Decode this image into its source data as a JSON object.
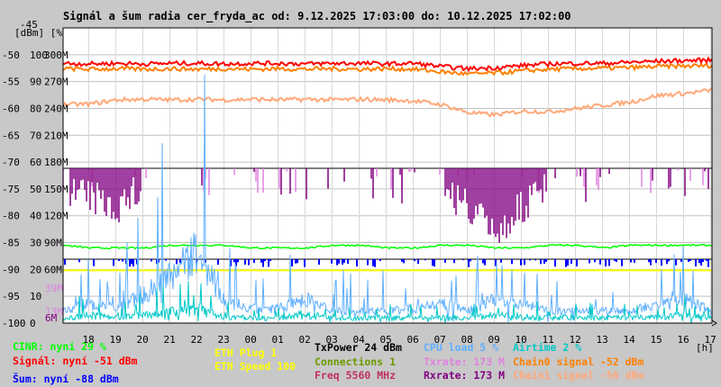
{
  "chart_data": {
    "type": "line",
    "title": "Signál a šum radia cer_fryda_ac od: 9.12.2025 17:03:00 do: 10.12.2025 17:02:00",
    "xlabel": "[h]",
    "ylabel_left": "[dBm] [%]",
    "x_ticks": [
      "18",
      "19",
      "20",
      "21",
      "22",
      "23",
      "00",
      "01",
      "02",
      "03",
      "04",
      "05",
      "06",
      "07",
      "08",
      "09",
      "10",
      "11",
      "12",
      "13",
      "14",
      "15",
      "16",
      "17"
    ],
    "y_ticks_dbm": [
      "-45",
      "-50",
      "-55",
      "-60",
      "-65",
      "-70",
      "-75",
      "-80",
      "-85",
      "-90",
      "-95",
      "-100"
    ],
    "y_ticks_pct": [
      "100",
      "90",
      "80",
      "70",
      "60",
      "50",
      "40",
      "30",
      "20",
      "10",
      "0"
    ],
    "y_ticks_rate": [
      "300M",
      "270M",
      "240M",
      "210M",
      "180M",
      "150M",
      "120M",
      "90M",
      "60M"
    ],
    "extra_rate_ticks": [
      "39M",
      "13M",
      "6M"
    ],
    "ylim_dbm": [
      -100,
      -45
    ],
    "x_hours_since_start": [
      0,
      1,
      2,
      3,
      4,
      5,
      6,
      7,
      8,
      9,
      10,
      11,
      12,
      13,
      14,
      15,
      16,
      17,
      18,
      19,
      20,
      21,
      22,
      23,
      24
    ],
    "series": [
      {
        "name": "Signal",
        "unit": "dBm",
        "color": "#ff0000",
        "values": [
          -51.6,
          -51.7,
          -51.6,
          -51.7,
          -51.6,
          -51.6,
          -51.7,
          -51.6,
          -51.6,
          -51.7,
          -51.6,
          -51.6,
          -51.7,
          -51.6,
          -52.2,
          -52.6,
          -52.4,
          -52.0,
          -51.7,
          -51.6,
          -51.6,
          -51.4,
          -51.2,
          -51.1,
          -51.0
        ]
      },
      {
        "name": "Chain0 signal",
        "unit": "dBm",
        "color": "#ff8000",
        "values": [
          -52.6,
          -52.7,
          -52.6,
          -52.7,
          -52.6,
          -52.7,
          -52.6,
          -52.7,
          -52.6,
          -52.7,
          -52.6,
          -52.7,
          -52.6,
          -52.7,
          -53.2,
          -53.6,
          -53.4,
          -53.0,
          -52.7,
          -52.6,
          -52.5,
          -52.4,
          -52.2,
          -52.1,
          -52.0
        ]
      },
      {
        "name": "Chain1 signal",
        "unit": "dBm",
        "color": "#ffa878",
        "values": [
          -59.3,
          -59.2,
          -58.4,
          -58.3,
          -58.4,
          -58.3,
          -58.4,
          -58.3,
          -58.4,
          -58.3,
          -58.4,
          -58.3,
          -58.4,
          -58.6,
          -59.3,
          -60.8,
          -61.2,
          -60.5,
          -60.6,
          -60.0,
          -59.4,
          -58.8,
          -57.6,
          -57.2,
          -56.6
        ]
      },
      {
        "name": "Noise",
        "unit": "dBm",
        "color": "#0000ff",
        "values": [
          -88.1,
          -88.1,
          -88.1,
          -88.1,
          -88.1,
          -88.1,
          -88.1,
          -88.1,
          -88.1,
          -88.1,
          -88.1,
          -88.1,
          -88.1,
          -88.1,
          -88.1,
          -88.1,
          -88.1,
          -88.1,
          -88.1,
          -88.1,
          -88.1,
          -88.1,
          -88.1,
          -88.1,
          -88.1
        ]
      },
      {
        "name": "CINR",
        "unit": "%",
        "color": "#00ff00",
        "values": [
          29,
          28,
          28,
          28,
          29,
          29,
          29,
          28,
          28,
          28,
          29,
          29,
          28,
          28,
          29,
          29,
          28,
          28,
          29,
          29,
          28,
          29,
          29,
          29,
          29
        ]
      },
      {
        "name": "Txrate",
        "unit": "M",
        "color": "#e080e0",
        "values": [
          173,
          173,
          173,
          173,
          173,
          173,
          173,
          173,
          173,
          173,
          173,
          173,
          173,
          173,
          173,
          173,
          173,
          173,
          173,
          173,
          173,
          173,
          173,
          173,
          173
        ]
      },
      {
        "name": "Rxrate",
        "unit": "M",
        "color": "#800080",
        "values": [
          173,
          160,
          150,
          173,
          173,
          173,
          173,
          173,
          173,
          173,
          173,
          173,
          173,
          173,
          173,
          150,
          120,
          150,
          173,
          173,
          173,
          173,
          173,
          173,
          173
        ]
      },
      {
        "name": "CPU load",
        "unit": "%",
        "color": "#60b0ff",
        "values": [
          5,
          8,
          6,
          12,
          20,
          30,
          8,
          6,
          6,
          10,
          5,
          5,
          5,
          6,
          8,
          5,
          10,
          8,
          5,
          5,
          5,
          5,
          8,
          10,
          5
        ]
      },
      {
        "name": "Airtime",
        "unit": "%",
        "color": "#00c8c8",
        "values": [
          2,
          3,
          2,
          3,
          4,
          5,
          2,
          2,
          2,
          3,
          2,
          2,
          2,
          2,
          2,
          2,
          3,
          2,
          2,
          2,
          2,
          2,
          2,
          3,
          2
        ]
      },
      {
        "name": "ETH Speed",
        "unit": "M",
        "color": "#ffff00",
        "values": [
          59,
          59,
          59,
          59,
          59,
          59,
          59,
          59,
          59,
          59,
          59,
          59,
          59,
          59,
          59,
          59,
          59,
          59,
          59,
          59,
          59,
          59,
          59,
          59,
          59
        ]
      }
    ],
    "legend": {
      "cinr": "CINR: nyní 29 %",
      "signal": "Signál: nyní -51 dBm",
      "noise": "Šum: nyní -88 dBm",
      "eth_plug": "ETH Plug 1",
      "eth_speed": "ETH Speed 100",
      "txpower": "TxPower 24 dBm",
      "connections": "Connections 1",
      "freq": "Freq 5560 MHz",
      "cpu": "CPU load 5 %",
      "txrate": "Txrate: 173 M",
      "rxrate": "Rxrate: 173 M",
      "airtime": "Airtime 2 %",
      "chain0": "Chain0 signal -52 dBm",
      "chain1": "Chain1 signal -56 dBm"
    },
    "colors": {
      "background": "#c8c8c8",
      "plot": "#ffffff",
      "grid": "#c0c0c0",
      "txpower": "#000000",
      "connections": "#6a9a00",
      "freq": "#c03060"
    }
  }
}
